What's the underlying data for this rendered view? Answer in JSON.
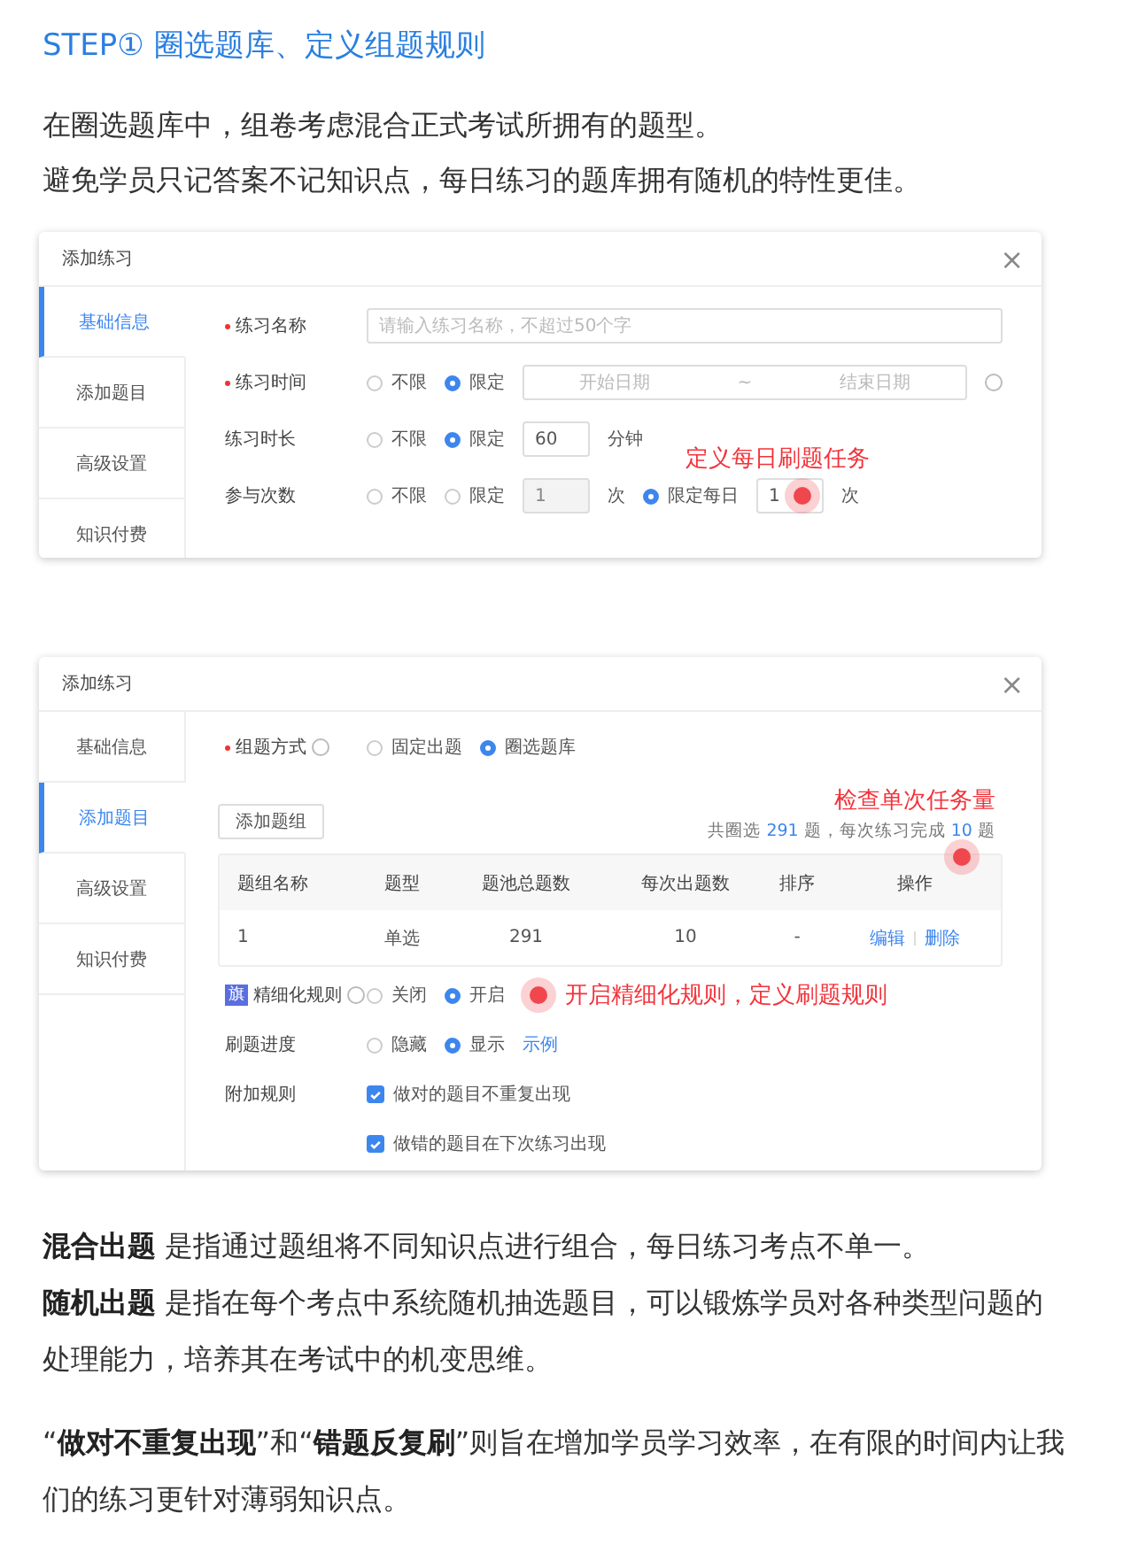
{
  "heading": "STEP① 圈选题库、定义组题规则",
  "intro": [
    "在圈选题库中，组卷考虑混合正式考试所拥有的题型。",
    "避免学员只记答案不记知识点，每日练习的题库拥有随机的特性更佳。"
  ],
  "dialogs": [
    {
      "title": "添加练习",
      "close": "×",
      "tabs": [
        {
          "label": "基础信息",
          "selected": true
        },
        {
          "label": "添加题目",
          "selected": false
        },
        {
          "label": "高级设置",
          "selected": false
        },
        {
          "label": "知识付费",
          "selected": false
        }
      ],
      "rows": [
        {
          "kind": "form",
          "label": "练习名称",
          "required": true,
          "items": [
            {
              "kind": "input",
              "placeholder": "请输入练习名称，不超过50个字"
            }
          ]
        },
        {
          "kind": "form",
          "label": "练习时间",
          "required": true,
          "items": [
            {
              "kind": "radio",
              "label": "不限",
              "selected": false
            },
            {
              "kind": "radio",
              "label": "限定",
              "selected": true
            },
            {
              "kind": "daterange",
              "start": "开始日期",
              "separator": "~",
              "end": "结束日期"
            },
            {
              "kind": "info"
            }
          ]
        },
        {
          "kind": "form",
          "label": "练习时长",
          "required": false,
          "items": [
            {
              "kind": "radio",
              "label": "不限",
              "selected": false
            },
            {
              "kind": "radio",
              "label": "限定",
              "selected": true
            },
            {
              "kind": "number",
              "value": "60",
              "disabled": false
            },
            {
              "kind": "unit",
              "text": "分钟"
            }
          ]
        },
        {
          "kind": "form",
          "label": "参与次数",
          "required": false,
          "items": [
            {
              "kind": "radio",
              "label": "不限",
              "selected": false
            },
            {
              "kind": "radio",
              "label": "限定",
              "selected": false
            },
            {
              "kind": "number",
              "value": "1",
              "disabled": true
            },
            {
              "kind": "unit",
              "text": "次"
            },
            {
              "kind": "radio",
              "label": "限定每日",
              "selected": true
            },
            {
              "kind": "number",
              "value": "1",
              "disabled": false,
              "dot": true,
              "callout": "定义每日刷题任务"
            },
            {
              "kind": "unit",
              "text": "次"
            }
          ]
        }
      ]
    },
    {
      "title": "添加练习",
      "close": "×",
      "tabs": [
        {
          "label": "基础信息",
          "selected": false
        },
        {
          "label": "添加题目",
          "selected": true
        },
        {
          "label": "高级设置",
          "selected": false
        },
        {
          "label": "知识付费",
          "selected": false
        }
      ],
      "rows": [
        {
          "kind": "form",
          "label": "组题方式",
          "required": true,
          "info": true,
          "items": [
            {
              "kind": "radio",
              "label": "固定出题",
              "selected": false
            },
            {
              "kind": "radio",
              "label": "圈选题库",
              "selected": true
            }
          ]
        },
        {
          "kind": "toolbar",
          "button": "添加题组",
          "summary": {
            "prefix": "共圈选",
            "count": "291",
            "middle": "题，每次练习完成",
            "per": "10",
            "suffix": "题",
            "callout": "检查单次任务量"
          }
        },
        {
          "kind": "table",
          "columns": [
            "题组名称",
            "题型",
            "题池总题数",
            "每次出题数",
            "排序",
            "操作"
          ],
          "rows": [
            {
              "cells": [
                "1",
                "单选",
                "291",
                "10",
                "-"
              ],
              "actions": [
                "编辑",
                "删除"
              ]
            }
          ]
        },
        {
          "kind": "form",
          "label": "精细化规则",
          "badge": "旗",
          "info": true,
          "required": false,
          "items": [
            {
              "kind": "radio",
              "label": "关闭",
              "selected": false
            },
            {
              "kind": "radio",
              "label": "开启",
              "selected": true
            },
            {
              "kind": "callout",
              "text": "开启精细化规则，定义刷题规则",
              "dot": true
            }
          ]
        },
        {
          "kind": "form",
          "label": "刷题进度",
          "required": false,
          "items": [
            {
              "kind": "radio",
              "label": "隐藏",
              "selected": false
            },
            {
              "kind": "radio",
              "label": "显示",
              "selected": true
            },
            {
              "kind": "link",
              "text": "示例"
            }
          ]
        },
        {
          "kind": "form",
          "label": "附加规则",
          "required": false,
          "items": [
            {
              "kind": "checkbox",
              "label": "做对的题目不重复出现",
              "checked": true
            }
          ]
        },
        {
          "kind": "form",
          "label": "",
          "required": false,
          "items": [
            {
              "kind": "checkbox",
              "label": "做错的题目在下次练习出现",
              "checked": true
            }
          ]
        }
      ]
    }
  ],
  "notes": [
    {
      "paragraphs": [
        "**混合出题** 是指通过题组将不同知识点进行组合，每日练习考点不单一。",
        "**随机出题** 是指在每个考点中系统随机抽选题目，可以锻炼学员对各种类型问题的处理能力，培养其在考试中的机变思维。"
      ]
    },
    {
      "paragraphs": [
        "“**做对不重复出现**”和“**错题反复刷**”则旨在增加学员学习效率，在有限的时间内让我们的练习更针对薄弱知识点。"
      ]
    }
  ]
}
